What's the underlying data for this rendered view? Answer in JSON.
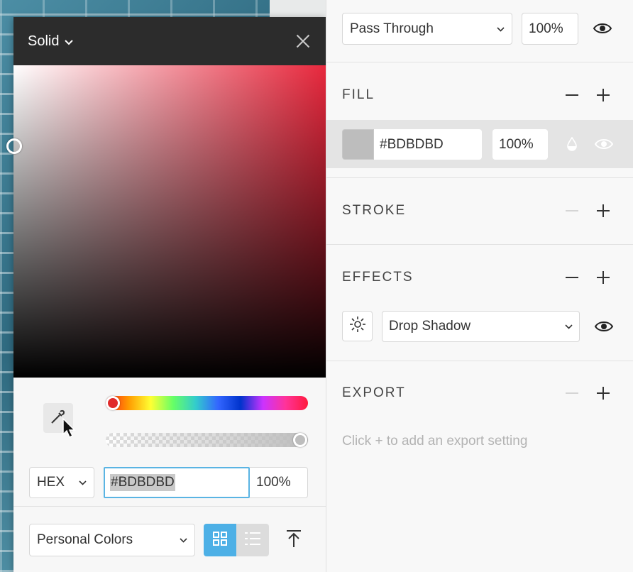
{
  "picker": {
    "mode_label": "Solid",
    "format_label": "HEX",
    "hex_value": "#BDBDBD",
    "alpha_value": "100%",
    "palette_label": "Personal Colors",
    "hue_color": "#e8283d",
    "current_color": "#BDBDBD"
  },
  "inspector": {
    "blend_mode": "Pass Through",
    "layer_opacity": "100%",
    "fill": {
      "title": "FILL",
      "hex": "#BDBDBD",
      "opacity": "100%"
    },
    "stroke": {
      "title": "STROKE"
    },
    "effects": {
      "title": "EFFECTS",
      "effect_type": "Drop Shadow"
    },
    "export": {
      "title": "EXPORT",
      "hint": "Click + to add an export setting"
    }
  },
  "colors": {
    "accent": "#4db0e6",
    "swatch": "#bdbdbd"
  }
}
